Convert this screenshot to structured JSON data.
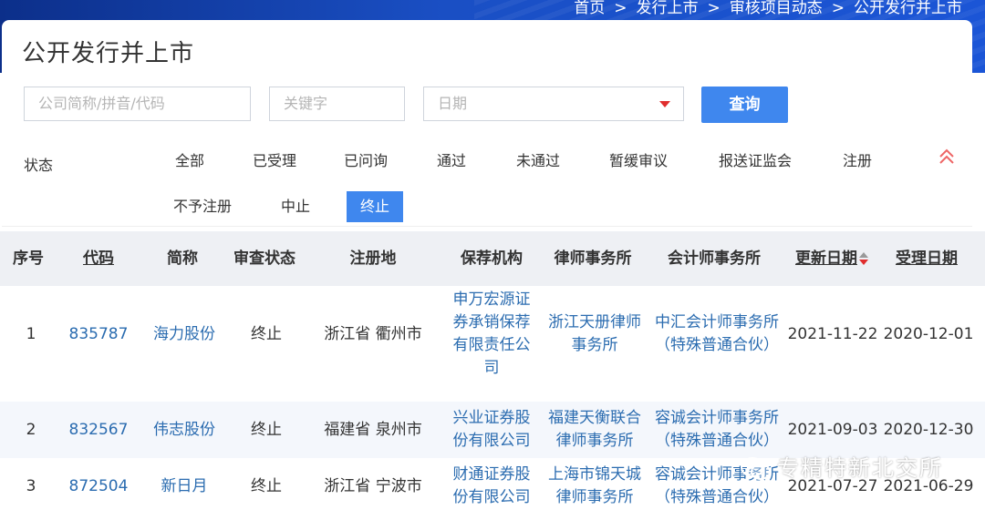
{
  "breadcrumb": [
    "首页",
    "发行上市",
    "审核项目动态",
    "公开发行并上市"
  ],
  "breadcrumb_sep": ">",
  "page_title": "公开发行并上市",
  "search": {
    "company_placeholder": "公司简称/拼音/代码",
    "keyword_placeholder": "关键字",
    "date_placeholder": "日期",
    "query_label": "查询"
  },
  "status": {
    "label": "状态",
    "options": [
      "全部",
      "已受理",
      "已问询",
      "通过",
      "未通过",
      "暂缓审议",
      "报送证监会",
      "注册",
      "不予注册",
      "中止",
      "终止"
    ],
    "selected": "终止"
  },
  "table": {
    "headers": [
      "序号",
      "代码",
      "简称",
      "审查状态",
      "注册地",
      "保荐机构",
      "律师事务所",
      "会计师事务所",
      "更新日期",
      "受理日期"
    ],
    "rows": [
      {
        "no": "1",
        "code": "835787",
        "name": "海力股份",
        "status": "终止",
        "place": "浙江省 衢州市",
        "sponsor": "申万宏源证券承销保荐有限责任公司",
        "lawyer": "浙江天册律师事务所",
        "accountant": "中汇会计师事务所（特殊普通合伙）",
        "updated": "2021-11-22",
        "accepted": "2020-12-01"
      },
      {
        "no": "2",
        "code": "832567",
        "name": "伟志股份",
        "status": "终止",
        "place": "福建省 泉州市",
        "sponsor": "兴业证券股份有限公司",
        "lawyer": "福建天衡联合律师事务所",
        "accountant": "容诚会计师事务所（特殊普通合伙）",
        "updated": "2021-09-03",
        "accepted": "2020-12-30"
      },
      {
        "no": "3",
        "code": "872504",
        "name": "新日月",
        "status": "终止",
        "place": "浙江省 宁波市",
        "sponsor": "财通证券股份有限公司",
        "lawyer": "上海市锦天城律师事务所",
        "accountant": "容诚会计师事务所（特殊普通合伙）",
        "updated": "2021-07-27",
        "accepted": "2021-06-29"
      }
    ]
  },
  "watermark": "专精特新北交所",
  "colors": {
    "accent": "#3f87ee",
    "link": "#2b6cb0",
    "header_bg": "#eef0f4",
    "caret": "#e02d2d"
  }
}
